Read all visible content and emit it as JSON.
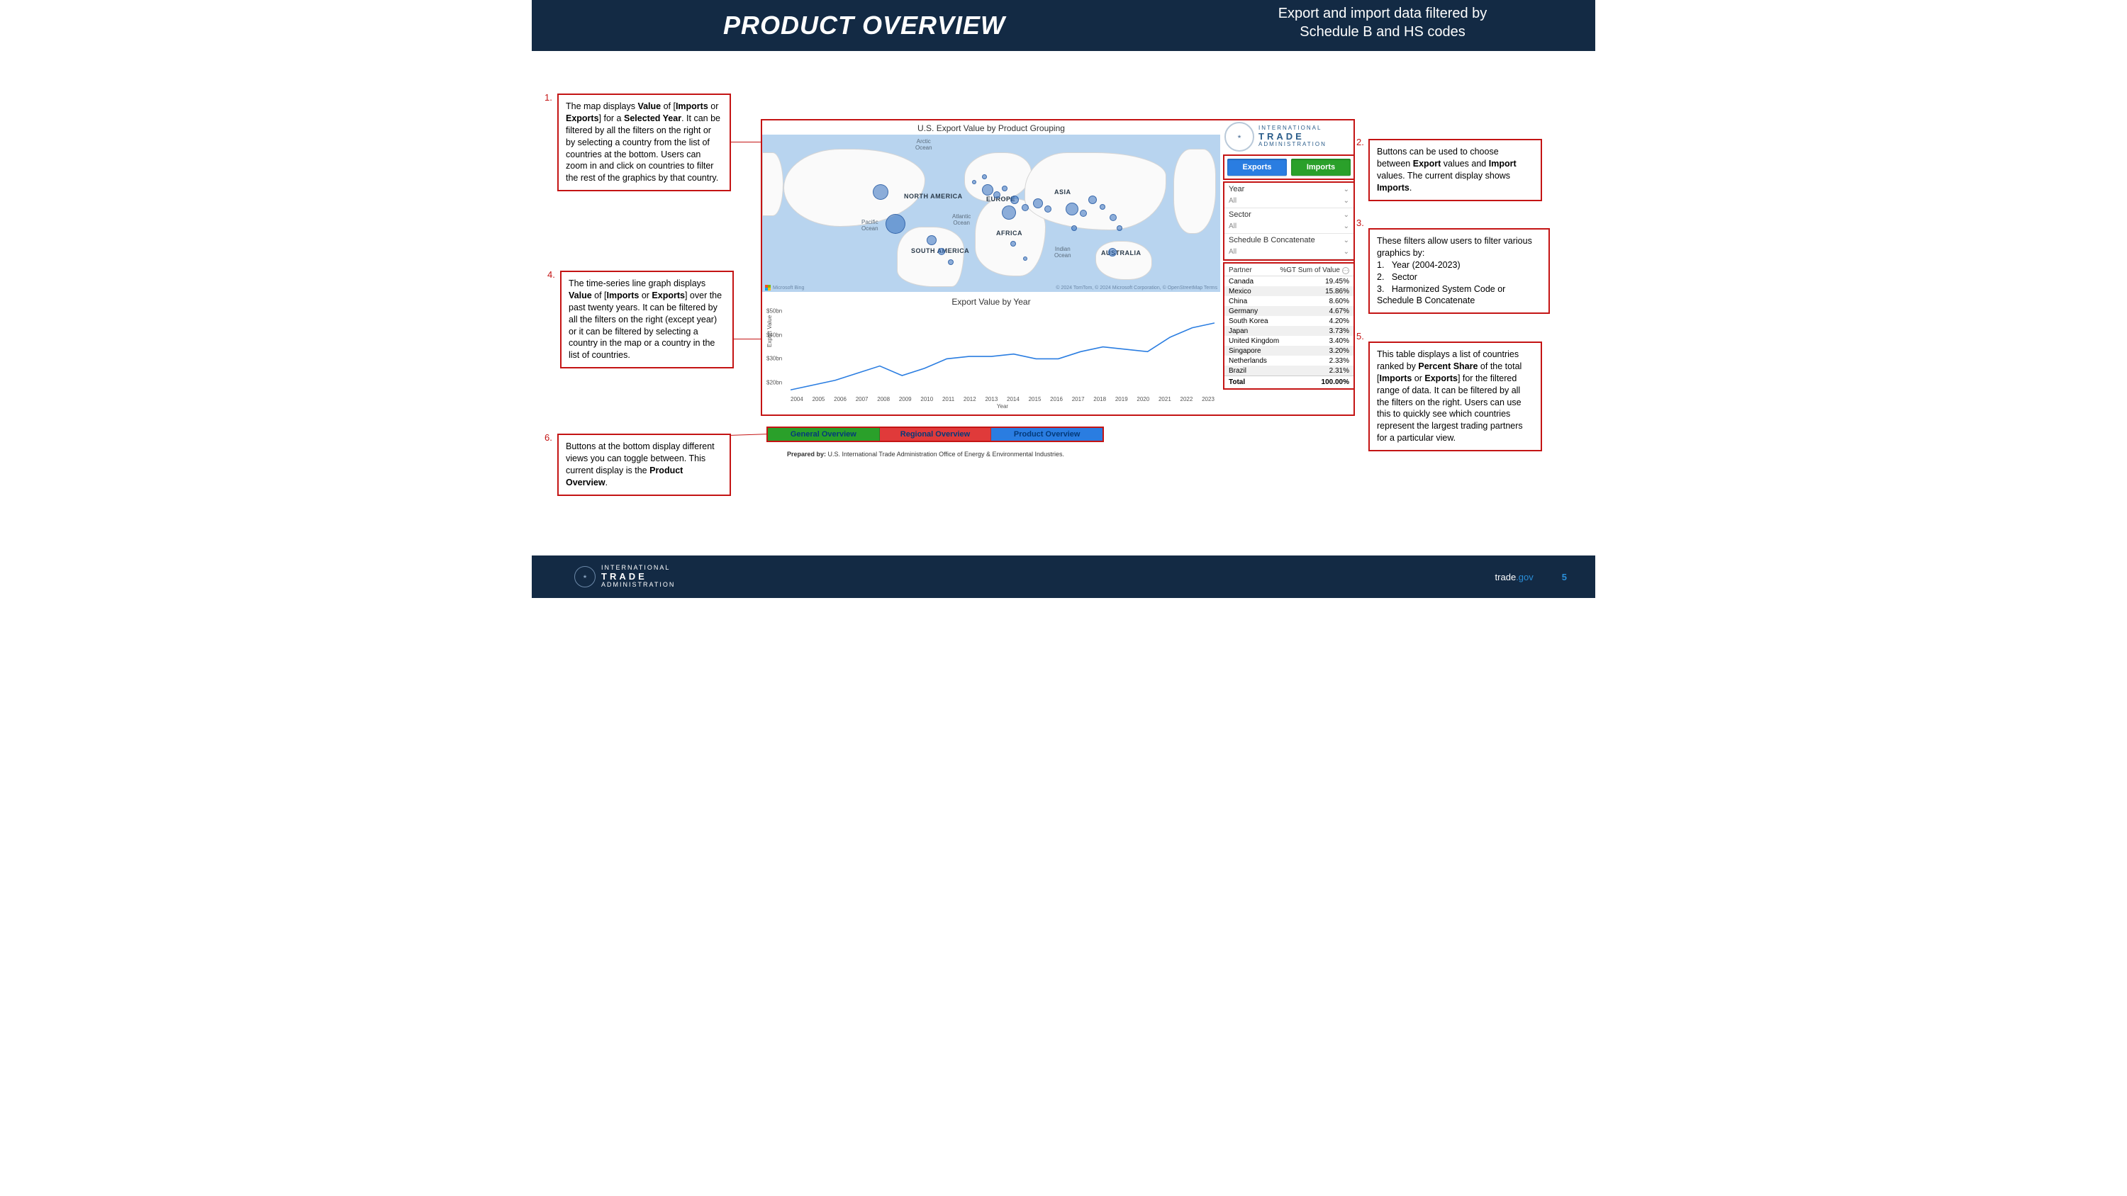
{
  "header": {
    "title": "PRODUCT OVERVIEW",
    "subtitle_line1": "Export and import data filtered by",
    "subtitle_line2": "Schedule B and HS codes"
  },
  "callouts": {
    "n1": {
      "num": "1.",
      "html": "The map displays <b>Value</b> of [<b>Imports</b> or <b>Exports</b>] for a <b>Selected Year</b>. It can be filtered by all the filters on the right or by selecting a country from the list of countries at the bottom. Users can zoom in and click on countries to filter the rest of the graphics by that country."
    },
    "n2": {
      "num": "2.",
      "html": "Buttons can be used to choose between <b>Export</b> values and <b>Import</b> values. The current display shows <b>Imports</b>."
    },
    "n3": {
      "num": "3.",
      "html": "These filters allow users to filter various graphics by:<br>1.&nbsp;&nbsp;&nbsp;Year (2004-2023)<br>2.&nbsp;&nbsp;&nbsp;Sector<br>3.&nbsp;&nbsp;&nbsp;Harmonized System Code or Schedule B Concatenate"
    },
    "n4": {
      "num": "4.",
      "html": "The time-series line graph displays <b>Value</b> of [<b>Imports</b> or <b>Exports</b>] over the past twenty years. It can be filtered by all the filters on the right (except year) or it can be filtered by selecting a country in the map or a country in the list of countries."
    },
    "n5": {
      "num": "5.",
      "html": "This table displays a list of countries ranked by <b>Percent Share</b> of the total [<b>Imports</b> or <b>Exports</b>] for the filtered range of data. It can be filtered by all the filters on the right.  Users can use this to quickly see which countries represent the largest trading partners for a particular view."
    },
    "n6": {
      "num": "6.",
      "html": "Buttons at the bottom display different views you can toggle between. This current display is the <b>Product Overview</b>."
    }
  },
  "dashboard": {
    "map": {
      "title": "U.S. Export Value by Product Grouping",
      "oceans": {
        "arctic": "Arctic\nOcean",
        "pacific": "Pacific\nOcean",
        "atlantic": "Atlantic\nOcean",
        "indian": "Indian\nOcean"
      },
      "continents": {
        "na": "NORTH AMERICA",
        "sa": "SOUTH AMERICA",
        "eu": "EUROPE",
        "af": "AFRICA",
        "as": "ASIA",
        "au": "AUSTRALIA"
      },
      "attrib_left": "Microsoft Bing",
      "attrib_right": "© 2024 TomTom, © 2024 Microsoft Corporation, © OpenStreetMap   Terms"
    },
    "line": {
      "title": "Export Value by Year",
      "ylabel": "Export Value",
      "xlabel": "Year"
    },
    "prepared_label": "Prepared by:",
    "prepared_value": " U.S. International Trade Administration Office of Energy & Environmental Industries."
  },
  "sidebar": {
    "brand": {
      "top": "INTERNATIONAL",
      "mid": "TRADE",
      "bot": "ADMINISTRATION"
    },
    "toggles": {
      "exports": "Exports",
      "imports": "Imports"
    },
    "filters": [
      {
        "label": "Year",
        "value": "All"
      },
      {
        "label": "Sector",
        "value": "All"
      },
      {
        "label": "Schedule B Concatenate",
        "value": "All"
      }
    ],
    "partner_table": {
      "col1": "Partner",
      "col2": "%GT Sum of Value",
      "rows": [
        {
          "name": "Canada",
          "pct": "19.45%"
        },
        {
          "name": "Mexico",
          "pct": "15.86%"
        },
        {
          "name": "China",
          "pct": "8.60%"
        },
        {
          "name": "Germany",
          "pct": "4.67%"
        },
        {
          "name": "South Korea",
          "pct": "4.20%"
        },
        {
          "name": "Japan",
          "pct": "3.73%"
        },
        {
          "name": "United Kingdom",
          "pct": "3.40%"
        },
        {
          "name": "Singapore",
          "pct": "3.20%"
        },
        {
          "name": "Netherlands",
          "pct": "2.33%"
        },
        {
          "name": "Brazil",
          "pct": "2.31%"
        }
      ],
      "total_label": "Total",
      "total_value": "100.00%"
    }
  },
  "nav_tabs": {
    "general": "General Overview",
    "regional": "Regional Overview",
    "product": "Product Overview"
  },
  "footer": {
    "brand": {
      "top": "INTERNATIONAL",
      "mid": "TRADE",
      "bot": "ADMINISTRATION"
    },
    "site_a": "trade",
    "site_b": ".gov",
    "page": "5"
  },
  "chart_data": {
    "type": "line",
    "title": "Export Value by Year",
    "xlabel": "Year",
    "ylabel": "Export Value",
    "ylim": [
      15,
      50
    ],
    "y_unit": "bn USD",
    "yticks": [
      "$20bn",
      "$30bn",
      "$40bn",
      "$50bn"
    ],
    "x": [
      2004,
      2005,
      2006,
      2007,
      2008,
      2009,
      2010,
      2011,
      2012,
      2013,
      2014,
      2015,
      2016,
      2017,
      2018,
      2019,
      2020,
      2021,
      2022,
      2023
    ],
    "values": [
      17,
      19,
      21,
      24,
      27,
      23,
      26,
      30,
      31,
      31,
      32,
      30,
      30,
      33,
      35,
      34,
      33,
      39,
      43,
      45
    ]
  }
}
